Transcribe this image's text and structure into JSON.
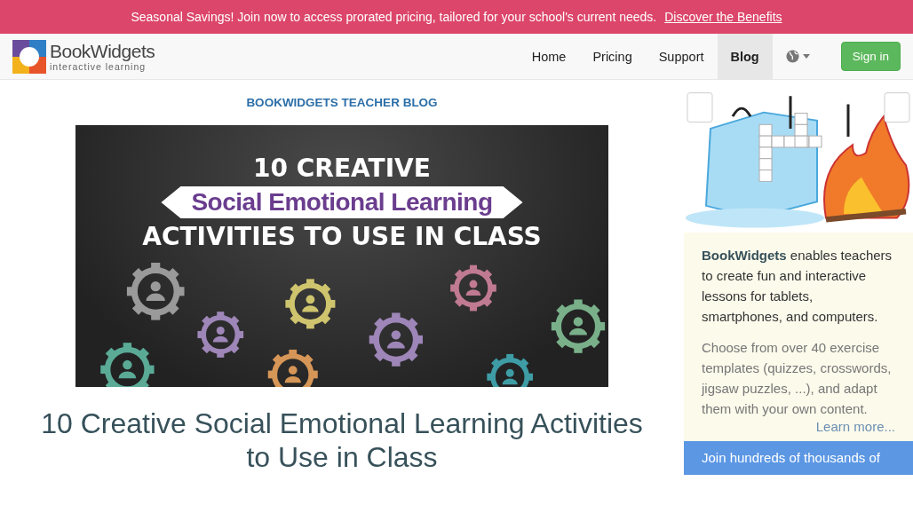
{
  "promo_bar": {
    "text": "Seasonal Savings! Join now to access prorated pricing, tailored for your school's current needs.",
    "link": "Discover the Benefits"
  },
  "header": {
    "logo": {
      "name": "BookWidgets",
      "tagline": "interactive learning"
    },
    "nav": [
      {
        "label": "Home",
        "selected": false
      },
      {
        "label": "Pricing",
        "selected": false
      },
      {
        "label": "Support",
        "selected": false
      },
      {
        "label": "Blog",
        "selected": true
      }
    ],
    "sign_in": "Sign in"
  },
  "article": {
    "kicker": "BOOKWIDGETS TEACHER BLOG",
    "hero": {
      "line_1": "10 CREATIVE",
      "line_2": "Social Emotional Learning",
      "line_3": "ACTIVITIES TO USE IN CLASS"
    },
    "title": "10 Creative Social Emotional Learning Activities to Use in Class"
  },
  "sidebar": {
    "intro": "**BookWidgets** enables teachers to create fun and interactive lessons for tablets, smartphones, and computers.",
    "details": "Choose from over 40 exercise templates (quizzes, crosswords, jigsaw puzzles, ...), and adapt them with your own content.",
    "learn_more": "Learn more...",
    "join": "Join hundreds of thousands of"
  }
}
